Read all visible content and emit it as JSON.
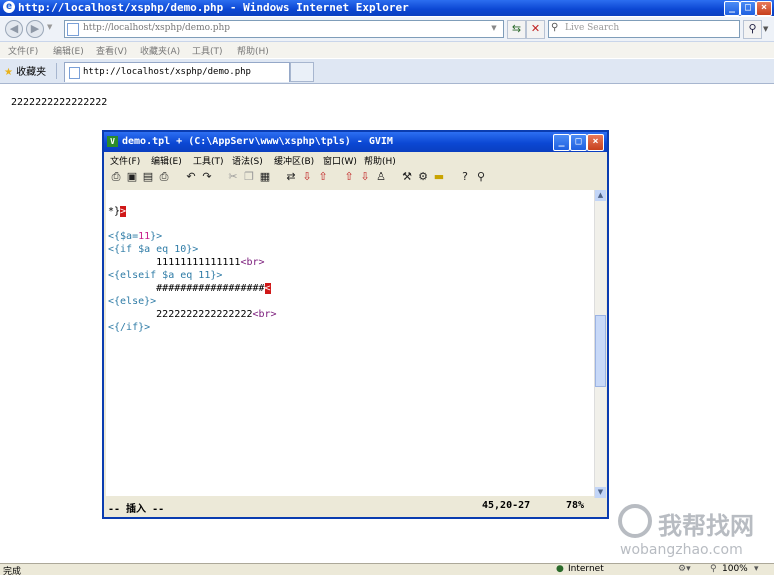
{
  "browser": {
    "window_title": "http://localhost/xsphp/demo.php - Windows Internet Explorer",
    "address": "http://localhost/xsphp/demo.php",
    "search_placeholder": "Live Search",
    "menu": [
      "文件(F)",
      "编辑(E)",
      "查看(V)",
      "收藏夹(A)",
      "工具(T)",
      "帮助(H)"
    ],
    "favorites_label": "收藏夹",
    "tab_title": "http://localhost/xsphp/demo.php",
    "page_text": "2222222222222222",
    "status_left": "完成",
    "status_zone": "Internet",
    "zoom": "100%"
  },
  "vim": {
    "window_title": "demo.tpl + (C:\\AppServ\\www\\xsphp\\tpls) - GVIM",
    "menu": [
      "文件(F)",
      "编辑(E)",
      "工具(T)",
      "语法(S)",
      "缓冲区(B)",
      "窗口(W)",
      "帮助(H)"
    ],
    "lines": {
      "l1a": "*}",
      "l1b": ">",
      "l2a": "<{$a=",
      "l2b": "11",
      "l2c": "}>",
      "l3": "<{if $a eq 10}>",
      "l4a": "        11111111111111",
      "l4b": "<br>",
      "l5": "<{elseif $a eq 11}>",
      "l6a": "        ##################",
      "l6b": "<",
      "l7": "<{else}>",
      "l8a": "        2222222222222222",
      "l8b": "<br>",
      "l9": "<{/if}>"
    },
    "status_mode": "-- 插入 --",
    "status_pos": "45,20-27",
    "status_pct": "78%"
  },
  "watermark": {
    "line1": "我帮找网",
    "line2": "wobangzhao.com"
  }
}
